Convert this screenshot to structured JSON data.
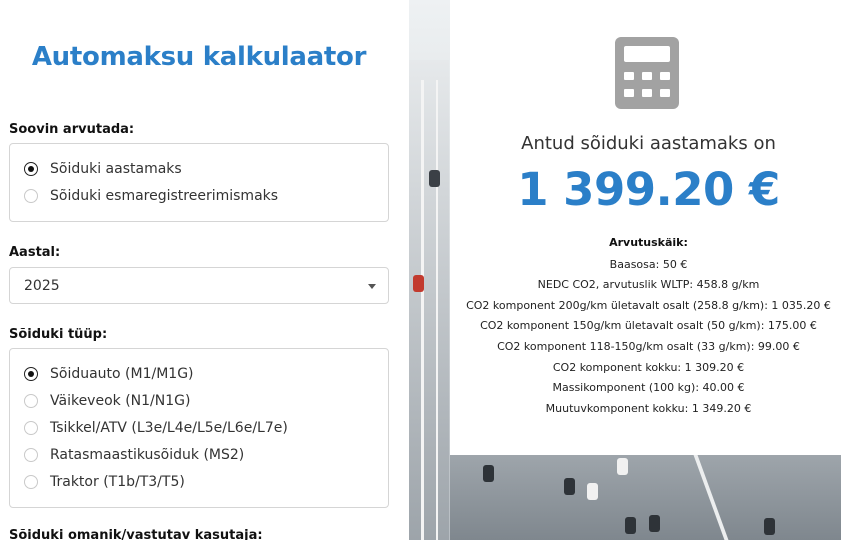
{
  "form": {
    "title": "Automaksu kalkulaator",
    "calc_type": {
      "label": "Soovin arvutada:",
      "options": [
        {
          "label": "Sõiduki aastamaks",
          "checked": true
        },
        {
          "label": "Sõiduki esmaregistreerimismaks",
          "checked": false
        }
      ]
    },
    "year": {
      "label": "Aastal:",
      "value": "2025"
    },
    "vehicle_type": {
      "label": "Sõiduki tüüp:",
      "options": [
        {
          "label": "Sõiduauto (M1/M1G)",
          "checked": true
        },
        {
          "label": "Väikeveok (N1/N1G)",
          "checked": false
        },
        {
          "label": "Tsikkel/ATV (L3e/L4e/L5e/L6e/L7e)",
          "checked": false
        },
        {
          "label": "Ratasmaastikusõiduk (MS2)",
          "checked": false
        },
        {
          "label": "Traktor (T1b/T3/T5)",
          "checked": false
        }
      ]
    },
    "owner_label": "Sõiduki omanik/vastutav kasutaja:"
  },
  "result": {
    "icon": "calculator-icon",
    "title": "Antud sõiduki aastamaks on",
    "value": "1 399.20 €",
    "breakdown_heading": "Arvutuskäik:",
    "breakdown": [
      "Baasosa: 50 €",
      "NEDC CO2, arvutuslik WLTP: 458.8 g/km",
      "CO2 komponent 200g/km ületavalt osalt (258.8 g/km): 1 035.20 €",
      "CO2 komponent 150g/km ületavalt osalt (50 g/km): 175.00 €",
      "CO2 komponent 118-150g/km osalt (33 g/km): 99.00 €",
      "CO2 komponent kokku: 1 309.20 €",
      "Massikomponent (100 kg): 40.00 €",
      "Muutuvkomponent kokku: 1 349.20 €"
    ]
  },
  "colors": {
    "accent": "#2b7fc8",
    "icon_gray": "#a2a2a2"
  }
}
